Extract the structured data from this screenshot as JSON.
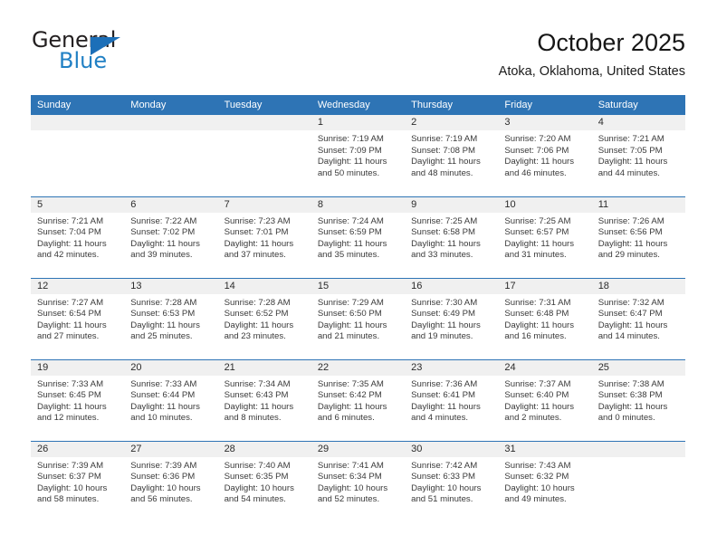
{
  "logo": {
    "word_one": "General",
    "word_two": "Blue",
    "triangle_color": "#1c6fb8",
    "blue_color": "#2180c4"
  },
  "header": {
    "title": "October 2025",
    "subtitle": "Atoka, Oklahoma, United States"
  },
  "theme": {
    "header_background": "#2e74b5",
    "header_text": "#ffffff",
    "daynum_background": "#f0f0f0",
    "divider": "#2e74b5"
  },
  "calendar": {
    "weekday_headers": [
      "Sunday",
      "Monday",
      "Tuesday",
      "Wednesday",
      "Thursday",
      "Friday",
      "Saturday"
    ],
    "weeks": [
      [
        {
          "day": "",
          "empty": true,
          "sunrise": "",
          "sunset": "",
          "daylight_a": "",
          "daylight_b": ""
        },
        {
          "day": "",
          "empty": true,
          "sunrise": "",
          "sunset": "",
          "daylight_a": "",
          "daylight_b": ""
        },
        {
          "day": "",
          "empty": true,
          "sunrise": "",
          "sunset": "",
          "daylight_a": "",
          "daylight_b": ""
        },
        {
          "day": "1",
          "sunrise": "Sunrise: 7:19 AM",
          "sunset": "Sunset: 7:09 PM",
          "daylight_a": "Daylight: 11 hours",
          "daylight_b": "and 50 minutes."
        },
        {
          "day": "2",
          "sunrise": "Sunrise: 7:19 AM",
          "sunset": "Sunset: 7:08 PM",
          "daylight_a": "Daylight: 11 hours",
          "daylight_b": "and 48 minutes."
        },
        {
          "day": "3",
          "sunrise": "Sunrise: 7:20 AM",
          "sunset": "Sunset: 7:06 PM",
          "daylight_a": "Daylight: 11 hours",
          "daylight_b": "and 46 minutes."
        },
        {
          "day": "4",
          "sunrise": "Sunrise: 7:21 AM",
          "sunset": "Sunset: 7:05 PM",
          "daylight_a": "Daylight: 11 hours",
          "daylight_b": "and 44 minutes."
        }
      ],
      [
        {
          "day": "5",
          "sunrise": "Sunrise: 7:21 AM",
          "sunset": "Sunset: 7:04 PM",
          "daylight_a": "Daylight: 11 hours",
          "daylight_b": "and 42 minutes."
        },
        {
          "day": "6",
          "sunrise": "Sunrise: 7:22 AM",
          "sunset": "Sunset: 7:02 PM",
          "daylight_a": "Daylight: 11 hours",
          "daylight_b": "and 39 minutes."
        },
        {
          "day": "7",
          "sunrise": "Sunrise: 7:23 AM",
          "sunset": "Sunset: 7:01 PM",
          "daylight_a": "Daylight: 11 hours",
          "daylight_b": "and 37 minutes."
        },
        {
          "day": "8",
          "sunrise": "Sunrise: 7:24 AM",
          "sunset": "Sunset: 6:59 PM",
          "daylight_a": "Daylight: 11 hours",
          "daylight_b": "and 35 minutes."
        },
        {
          "day": "9",
          "sunrise": "Sunrise: 7:25 AM",
          "sunset": "Sunset: 6:58 PM",
          "daylight_a": "Daylight: 11 hours",
          "daylight_b": "and 33 minutes."
        },
        {
          "day": "10",
          "sunrise": "Sunrise: 7:25 AM",
          "sunset": "Sunset: 6:57 PM",
          "daylight_a": "Daylight: 11 hours",
          "daylight_b": "and 31 minutes."
        },
        {
          "day": "11",
          "sunrise": "Sunrise: 7:26 AM",
          "sunset": "Sunset: 6:56 PM",
          "daylight_a": "Daylight: 11 hours",
          "daylight_b": "and 29 minutes."
        }
      ],
      [
        {
          "day": "12",
          "sunrise": "Sunrise: 7:27 AM",
          "sunset": "Sunset: 6:54 PM",
          "daylight_a": "Daylight: 11 hours",
          "daylight_b": "and 27 minutes."
        },
        {
          "day": "13",
          "sunrise": "Sunrise: 7:28 AM",
          "sunset": "Sunset: 6:53 PM",
          "daylight_a": "Daylight: 11 hours",
          "daylight_b": "and 25 minutes."
        },
        {
          "day": "14",
          "sunrise": "Sunrise: 7:28 AM",
          "sunset": "Sunset: 6:52 PM",
          "daylight_a": "Daylight: 11 hours",
          "daylight_b": "and 23 minutes."
        },
        {
          "day": "15",
          "sunrise": "Sunrise: 7:29 AM",
          "sunset": "Sunset: 6:50 PM",
          "daylight_a": "Daylight: 11 hours",
          "daylight_b": "and 21 minutes."
        },
        {
          "day": "16",
          "sunrise": "Sunrise: 7:30 AM",
          "sunset": "Sunset: 6:49 PM",
          "daylight_a": "Daylight: 11 hours",
          "daylight_b": "and 19 minutes."
        },
        {
          "day": "17",
          "sunrise": "Sunrise: 7:31 AM",
          "sunset": "Sunset: 6:48 PM",
          "daylight_a": "Daylight: 11 hours",
          "daylight_b": "and 16 minutes."
        },
        {
          "day": "18",
          "sunrise": "Sunrise: 7:32 AM",
          "sunset": "Sunset: 6:47 PM",
          "daylight_a": "Daylight: 11 hours",
          "daylight_b": "and 14 minutes."
        }
      ],
      [
        {
          "day": "19",
          "sunrise": "Sunrise: 7:33 AM",
          "sunset": "Sunset: 6:45 PM",
          "daylight_a": "Daylight: 11 hours",
          "daylight_b": "and 12 minutes."
        },
        {
          "day": "20",
          "sunrise": "Sunrise: 7:33 AM",
          "sunset": "Sunset: 6:44 PM",
          "daylight_a": "Daylight: 11 hours",
          "daylight_b": "and 10 minutes."
        },
        {
          "day": "21",
          "sunrise": "Sunrise: 7:34 AM",
          "sunset": "Sunset: 6:43 PM",
          "daylight_a": "Daylight: 11 hours",
          "daylight_b": "and 8 minutes."
        },
        {
          "day": "22",
          "sunrise": "Sunrise: 7:35 AM",
          "sunset": "Sunset: 6:42 PM",
          "daylight_a": "Daylight: 11 hours",
          "daylight_b": "and 6 minutes."
        },
        {
          "day": "23",
          "sunrise": "Sunrise: 7:36 AM",
          "sunset": "Sunset: 6:41 PM",
          "daylight_a": "Daylight: 11 hours",
          "daylight_b": "and 4 minutes."
        },
        {
          "day": "24",
          "sunrise": "Sunrise: 7:37 AM",
          "sunset": "Sunset: 6:40 PM",
          "daylight_a": "Daylight: 11 hours",
          "daylight_b": "and 2 minutes."
        },
        {
          "day": "25",
          "sunrise": "Sunrise: 7:38 AM",
          "sunset": "Sunset: 6:38 PM",
          "daylight_a": "Daylight: 11 hours",
          "daylight_b": "and 0 minutes."
        }
      ],
      [
        {
          "day": "26",
          "sunrise": "Sunrise: 7:39 AM",
          "sunset": "Sunset: 6:37 PM",
          "daylight_a": "Daylight: 10 hours",
          "daylight_b": "and 58 minutes."
        },
        {
          "day": "27",
          "sunrise": "Sunrise: 7:39 AM",
          "sunset": "Sunset: 6:36 PM",
          "daylight_a": "Daylight: 10 hours",
          "daylight_b": "and 56 minutes."
        },
        {
          "day": "28",
          "sunrise": "Sunrise: 7:40 AM",
          "sunset": "Sunset: 6:35 PM",
          "daylight_a": "Daylight: 10 hours",
          "daylight_b": "and 54 minutes."
        },
        {
          "day": "29",
          "sunrise": "Sunrise: 7:41 AM",
          "sunset": "Sunset: 6:34 PM",
          "daylight_a": "Daylight: 10 hours",
          "daylight_b": "and 52 minutes."
        },
        {
          "day": "30",
          "sunrise": "Sunrise: 7:42 AM",
          "sunset": "Sunset: 6:33 PM",
          "daylight_a": "Daylight: 10 hours",
          "daylight_b": "and 51 minutes."
        },
        {
          "day": "31",
          "sunrise": "Sunrise: 7:43 AM",
          "sunset": "Sunset: 6:32 PM",
          "daylight_a": "Daylight: 10 hours",
          "daylight_b": "and 49 minutes."
        },
        {
          "day": "",
          "empty": true,
          "sunrise": "",
          "sunset": "",
          "daylight_a": "",
          "daylight_b": ""
        }
      ]
    ]
  }
}
